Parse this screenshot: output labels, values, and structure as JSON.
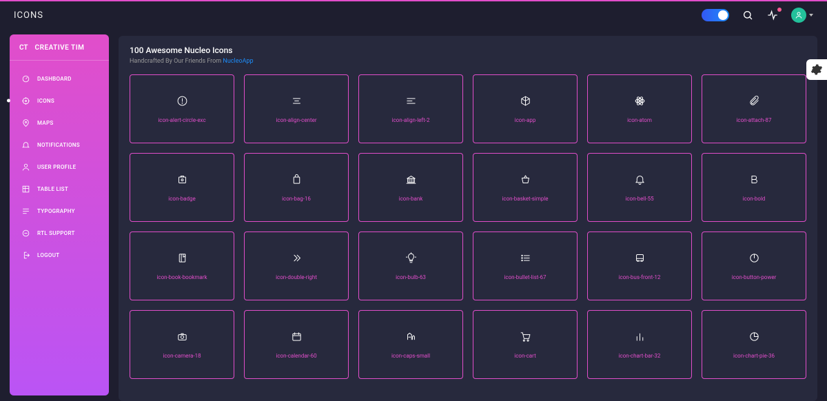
{
  "topbar": {
    "title": "ICONS"
  },
  "brand": {
    "logo": "CT",
    "name": "CREATIVE TIM"
  },
  "sidebar": {
    "items": [
      {
        "label": "DASHBOARD"
      },
      {
        "label": "ICONS"
      },
      {
        "label": "MAPS"
      },
      {
        "label": "NOTIFICATIONS"
      },
      {
        "label": "USER PROFILE"
      },
      {
        "label": "TABLE LIST"
      },
      {
        "label": "TYPOGRAPHY"
      },
      {
        "label": "RTL SUPPORT"
      },
      {
        "label": "LOGOUT"
      }
    ]
  },
  "header": {
    "title": "100 Awesome Nucleo Icons",
    "subtitle_prefix": "Handcrafted By Our Friends From ",
    "subtitle_link": "NucleoApp"
  },
  "icons": [
    {
      "label": "icon-alert-circle-exc",
      "glyph": "alert"
    },
    {
      "label": "icon-align-center",
      "glyph": "align-center"
    },
    {
      "label": "icon-align-left-2",
      "glyph": "align-left"
    },
    {
      "label": "icon-app",
      "glyph": "cube"
    },
    {
      "label": "icon-atom",
      "glyph": "atom"
    },
    {
      "label": "icon-attach-87",
      "glyph": "paperclip"
    },
    {
      "label": "icon-badge",
      "glyph": "badge"
    },
    {
      "label": "icon-bag-16",
      "glyph": "bag"
    },
    {
      "label": "icon-bank",
      "glyph": "bank"
    },
    {
      "label": "icon-basket-simple",
      "glyph": "basket"
    },
    {
      "label": "icon-bell-55",
      "glyph": "bell"
    },
    {
      "label": "icon-bold",
      "glyph": "bold"
    },
    {
      "label": "icon-book-bookmark",
      "glyph": "book"
    },
    {
      "label": "icon-double-right",
      "glyph": "chevrons-right"
    },
    {
      "label": "icon-bulb-63",
      "glyph": "bulb"
    },
    {
      "label": "icon-bullet-list-67",
      "glyph": "list"
    },
    {
      "label": "icon-bus-front-12",
      "glyph": "bus"
    },
    {
      "label": "icon-button-power",
      "glyph": "power"
    },
    {
      "label": "icon-camera-18",
      "glyph": "camera"
    },
    {
      "label": "icon-calendar-60",
      "glyph": "calendar"
    },
    {
      "label": "icon-caps-small",
      "glyph": "caps"
    },
    {
      "label": "icon-cart",
      "glyph": "cart"
    },
    {
      "label": "icon-chart-bar-32",
      "glyph": "bar-chart"
    },
    {
      "label": "icon-chart-pie-36",
      "glyph": "pie-chart"
    }
  ]
}
